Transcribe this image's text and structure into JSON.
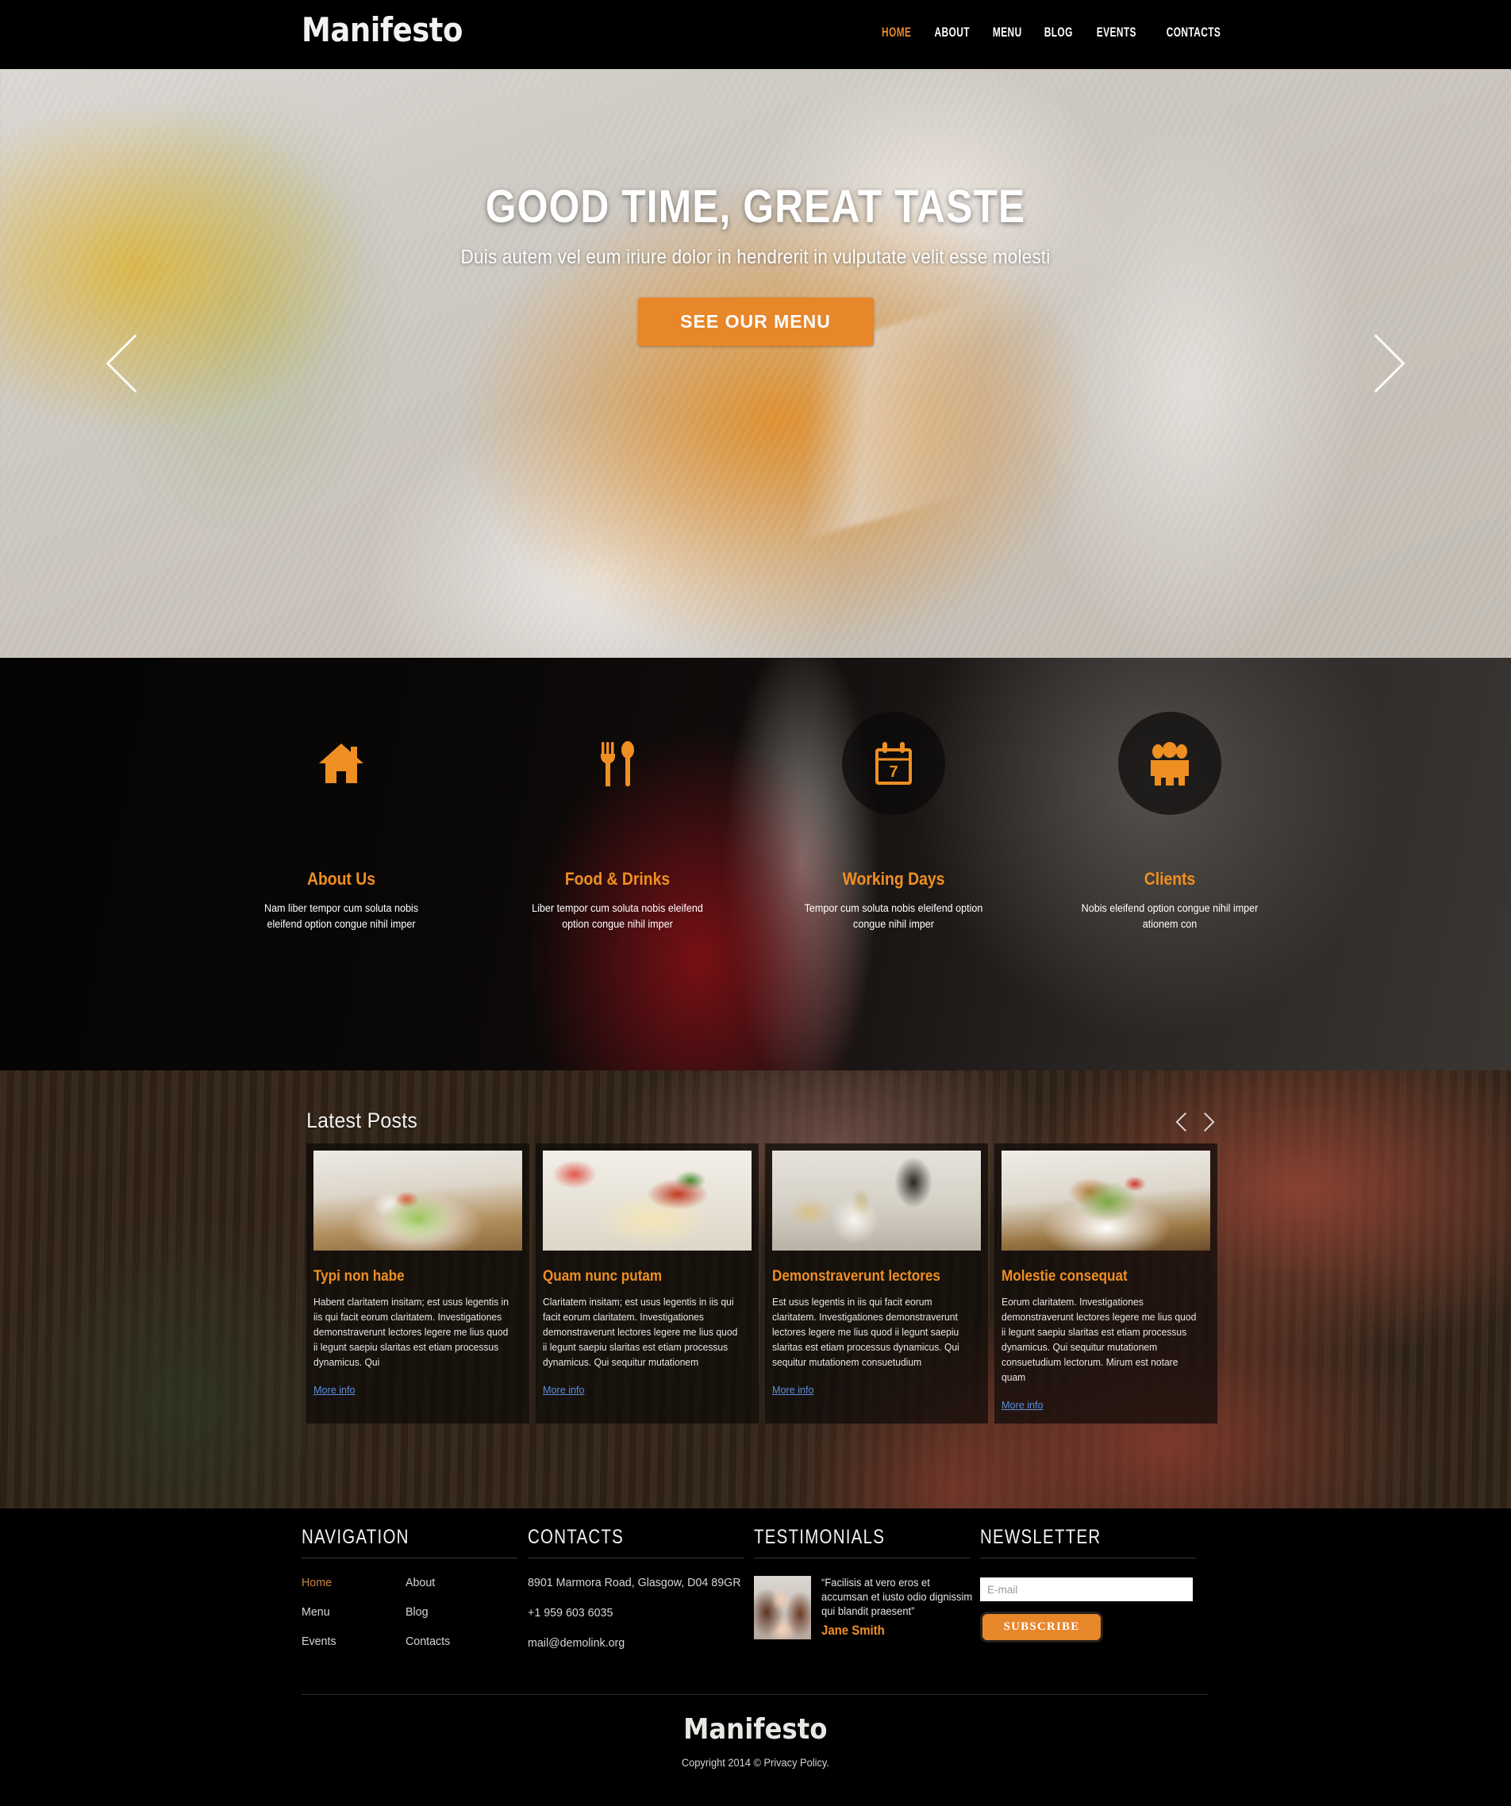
{
  "brand": {
    "name": "Manifesto",
    "accent": "#e8862a",
    "nav_active_color": "#e8852a"
  },
  "header": {
    "nav": [
      {
        "label": "HOME",
        "active": true
      },
      {
        "label": "ABOUT",
        "active": false
      },
      {
        "label": "MENU",
        "active": false
      },
      {
        "label": "BLOG",
        "active": false
      },
      {
        "label": "EVENTS",
        "active": false
      },
      {
        "label": "CONTACTS",
        "active": false
      }
    ]
  },
  "hero": {
    "title": "GOOD TIME, GREAT TASTE",
    "subtitle": "Duis autem vel eum iriure dolor in hendrerit in vulputate velit esse molesti",
    "cta_label": "SEE OUR MENU",
    "prev_icon": "chevron-left-icon",
    "next_icon": "chevron-right-icon"
  },
  "features": [
    {
      "icon": "home-icon",
      "title": "About Us",
      "text": "Nam liber tempor cum soluta nobis eleifend option congue nihil imper"
    },
    {
      "icon": "fork-spoon-icon",
      "title": "Food & Drinks",
      "text": "Liber tempor cum soluta nobis eleifend option congue nihil imper"
    },
    {
      "icon": "calendar-icon",
      "title": "Working Days",
      "text": "Tempor cum soluta nobis eleifend option congue nihil imper",
      "calendar_day": "7"
    },
    {
      "icon": "people-icon",
      "title": "Clients",
      "text": "Nobis eleifend option congue nihil imper ationem con"
    }
  ],
  "blog": {
    "heading": "Latest Posts",
    "prev_icon": "chevron-left-icon",
    "next_icon": "chevron-right-icon",
    "posts": [
      {
        "title": "Typi non habe",
        "text": "Habent claritatem insitam; est usus legentis in iis qui facit eorum claritatem. Investigationes demonstraverunt lectores legere me lius quod ii legunt saepiu slaritas est etiam processus dynamicus. Qui",
        "link_label": "More info",
        "image": "salad-plate-photo"
      },
      {
        "title": "Quam nunc putam",
        "text": "Claritatem insitam; est usus legentis in iis qui facit eorum claritatem. Investigationes demonstraverunt lectores legere me lius quod ii legunt saepiu slaritas est etiam processus dynamicus. Qui sequitur mutationem",
        "link_label": "More info",
        "image": "spaghetti-photo"
      },
      {
        "title": "Demonstraverunt lectores",
        "text": "Est usus legentis in iis qui facit eorum claritatem. Investigationes demonstraverunt lectores legere me lius quod ii legunt saepiu slaritas est etiam processus dynamicus. Qui sequitur mutationem consuetudium",
        "link_label": "More info",
        "image": "fine-dining-dish-photo"
      },
      {
        "title": "Molestie consequat",
        "text": "Eorum claritatem. Investigationes demonstraverunt lectores legere me lius quod ii legunt saepiu slaritas est etiam processus dynamicus. Qui sequitur mutationem consuetudium lectorum. Mirum est notare quam",
        "link_label": "More info",
        "image": "shrimp-salad-bowl-photo"
      }
    ]
  },
  "footer": {
    "navigation": {
      "title": "NAVIGATION",
      "col1": [
        {
          "label": "Home",
          "active": true
        },
        {
          "label": "Menu",
          "active": false
        },
        {
          "label": "Events",
          "active": false
        }
      ],
      "col2": [
        {
          "label": "About",
          "active": false
        },
        {
          "label": "Blog",
          "active": false
        },
        {
          "label": "Contacts",
          "active": false
        }
      ]
    },
    "contacts": {
      "title": "CONTACTS",
      "address": "8901 Marmora Road, Glasgow, D04 89GR",
      "phone": "+1 959 603 6035",
      "email": "mail@demolink.org"
    },
    "testimonials": {
      "title": "TESTIMONIALS",
      "quote": "“Facilisis at vero eros et accumsan et iusto odio dignissim qui blandit praesent”",
      "author": "Jane Smith",
      "avatar": "jane-smith-photo"
    },
    "newsletter": {
      "title": "NEWSLETTER",
      "input_placeholder": "E-mail",
      "input_value": "",
      "button_label": "SUBSCRIBE"
    },
    "bottom": {
      "logo": "Manifesto",
      "copyright": "Copyright 2014 © Privacy Policy."
    }
  }
}
